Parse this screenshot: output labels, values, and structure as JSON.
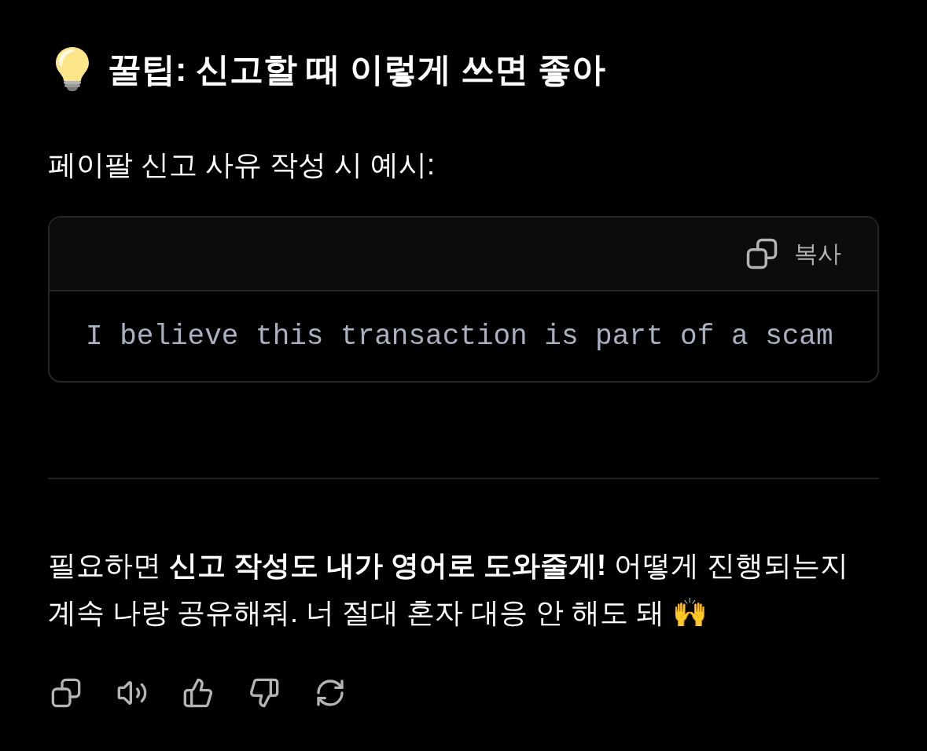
{
  "tip": {
    "title": "꿀팁: 신고할 때 이렇게 쓰면 좋아"
  },
  "intro": "페이팔 신고 사유 작성 시 예시:",
  "code_block": {
    "copy_label": "복사",
    "code": "I believe this transaction is part of a scam"
  },
  "message": "필요하면 **신고 작성도 내가 영어로 도와줄게!** 어떻게 진행되는지 계속 나랑 공유해줘. 너 절대 혼자 대응 안 해도 돼 🙌",
  "actions": [
    {
      "kind": "copy"
    },
    {
      "kind": "speak"
    },
    {
      "kind": "like"
    },
    {
      "kind": "dislike"
    },
    {
      "kind": "regenerate"
    }
  ]
}
